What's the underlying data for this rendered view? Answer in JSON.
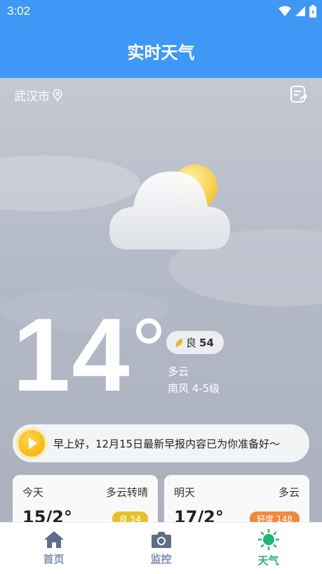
{
  "status": {
    "time": "3:02"
  },
  "appbar": {
    "title": "实时天气"
  },
  "location": {
    "city": "武汉市"
  },
  "current": {
    "temperature": "14",
    "aqi_label": "良",
    "aqi_value": "54",
    "condition": "多云",
    "wind": "南风 4-5级"
  },
  "banner": {
    "text": "早上好，12月15日最新早报内容已为你准备好〜"
  },
  "forecast": [
    {
      "day": "今天",
      "condition": "多云转晴",
      "temp": "15/2°",
      "aqi": "良 54",
      "aqi_color": "#e6c12a"
    },
    {
      "day": "明天",
      "condition": "多云",
      "temp": "17/2°",
      "aqi": "轻度 148",
      "aqi_color": "#f08a3c"
    }
  ],
  "tabs": [
    {
      "label": "首页",
      "icon": "home-icon"
    },
    {
      "label": "监控",
      "icon": "camera-icon"
    },
    {
      "label": "天气",
      "icon": "sun-icon",
      "active": true
    }
  ],
  "colors": {
    "primary": "#3f98f6",
    "active_tab": "#21b577",
    "inactive_tab": "#7f8fb0"
  }
}
